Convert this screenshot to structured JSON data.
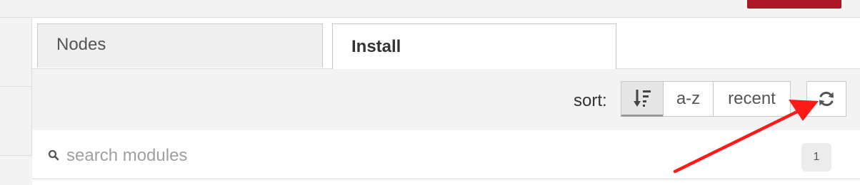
{
  "tabs": [
    {
      "label": "Nodes",
      "active": false
    },
    {
      "label": "Install",
      "active": true
    }
  ],
  "toolbar": {
    "sort_label": "sort:",
    "sort_options": [
      {
        "icon": "sort-relevance-icon",
        "selected": true
      },
      {
        "label": "a-z",
        "selected": false
      },
      {
        "label": "recent",
        "selected": false
      }
    ],
    "refresh_icon": "refresh-icon"
  },
  "search": {
    "icon": "search-icon",
    "placeholder": "search modules",
    "count": "1"
  },
  "annotation": {
    "type": "arrow",
    "color": "#ff1a1a"
  },
  "colors": {
    "accent": "#ad1625",
    "arrow": "#ff1a1a"
  }
}
